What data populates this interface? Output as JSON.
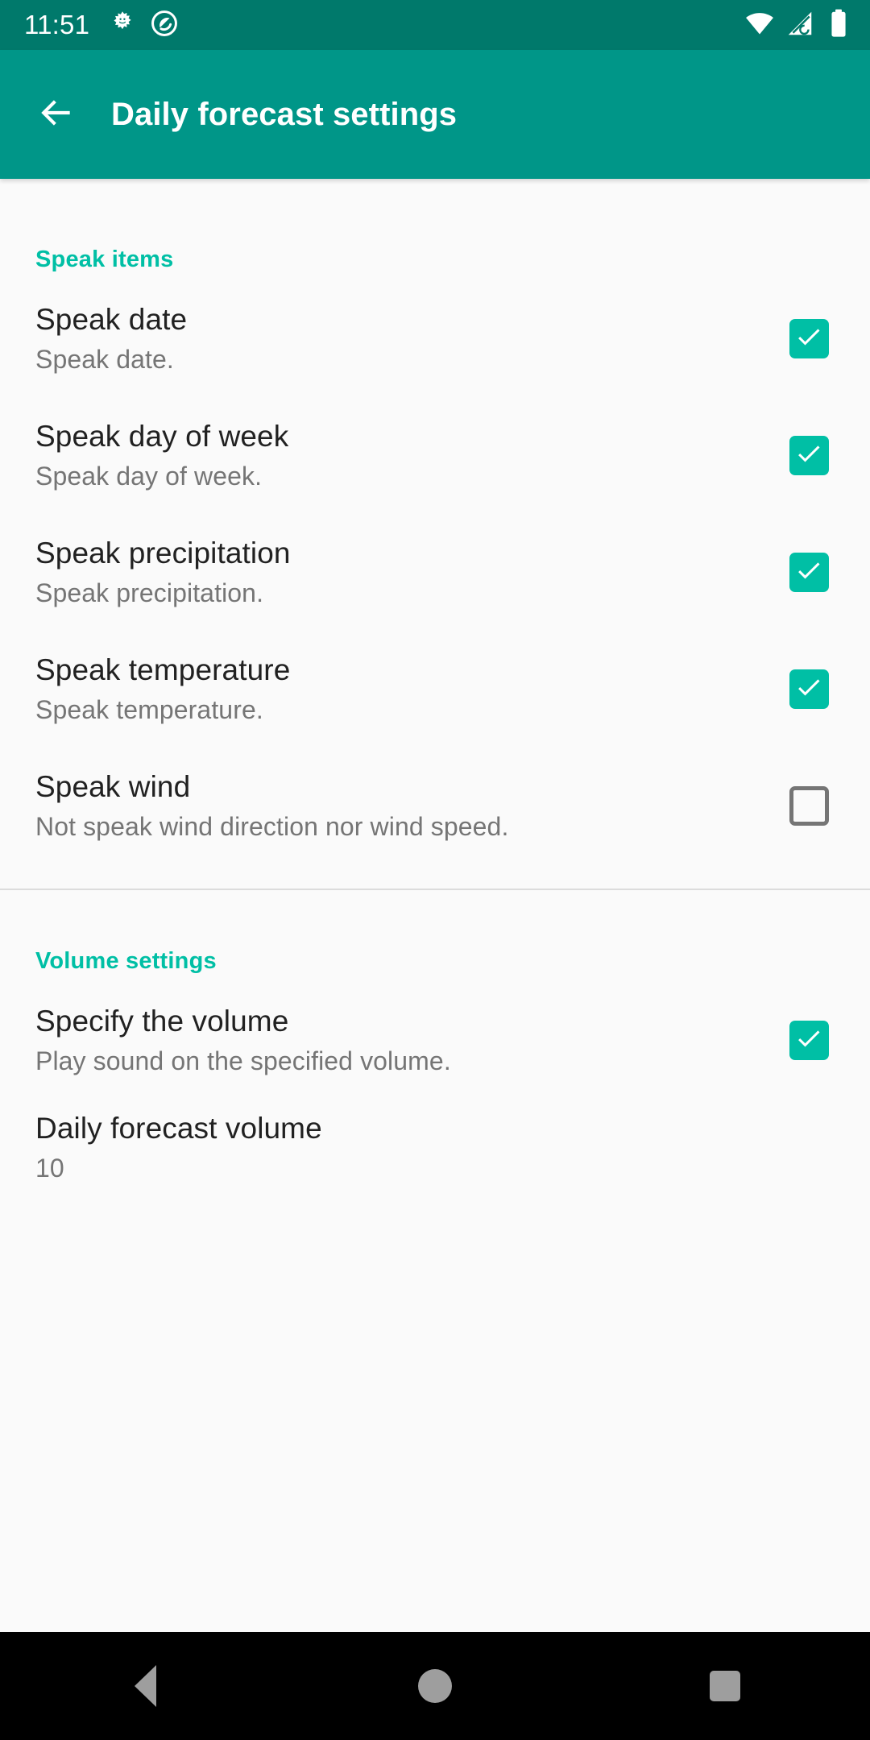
{
  "status_bar": {
    "clock": "11:51",
    "left_icons": [
      "sun-face-icon",
      "circle-logo-icon"
    ],
    "right_icons": [
      "wifi-icon",
      "cell-signal-no-sim-icon",
      "battery-full-icon"
    ],
    "background_color": "#00796b"
  },
  "app_bar": {
    "back_icon": "arrow-back-icon",
    "title": "Daily forecast settings",
    "background_color": "#009688",
    "title_color": "#ffffff"
  },
  "theme": {
    "accent_color": "#00bfa5",
    "page_background": "#fafafa",
    "title_text_color": "#212121",
    "summary_text_color": "#757575",
    "divider_color": "#dcdcdc"
  },
  "sections": [
    {
      "header": "Speak items",
      "items": [
        {
          "title": "Speak date",
          "summary": "Speak date.",
          "checkbox": "checked"
        },
        {
          "title": "Speak day of week",
          "summary": "Speak day of week.",
          "checkbox": "checked"
        },
        {
          "title": "Speak precipitation",
          "summary": "Speak precipitation.",
          "checkbox": "checked"
        },
        {
          "title": "Speak temperature",
          "summary": "Speak temperature.",
          "checkbox": "checked"
        },
        {
          "title": "Speak wind",
          "summary": "Not speak wind direction nor wind speed.",
          "checkbox": "unchecked"
        }
      ]
    },
    {
      "header": "Volume settings",
      "items": [
        {
          "title": "Specify the volume",
          "summary": "Play sound on the specified volume.",
          "checkbox": "checked"
        },
        {
          "title": "Daily forecast volume",
          "summary": "10",
          "checkbox": "none"
        }
      ]
    }
  ],
  "nav_bar": {
    "back_label": "back-button",
    "home_label": "home-button",
    "recents_label": "recents-button",
    "background_color": "#000000",
    "icon_color": "#9e9e9e"
  }
}
